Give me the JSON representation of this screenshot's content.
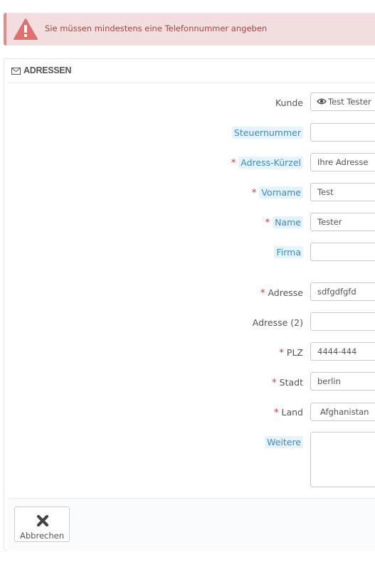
{
  "alert": {
    "message": "Sie müssen mindestens eine Telefonnummer angeben",
    "icon": "warning-icon",
    "color": "#a94442"
  },
  "panel": {
    "title": "ADRESSEN",
    "icon": "envelope-icon"
  },
  "form": {
    "customer_label": "Kunde",
    "customer_value": "Test Tester",
    "tax_number_label": "Steuernummer",
    "tax_number_value": "",
    "alias_label": "Adress-Kürzel",
    "alias_value": "Ihre Adresse",
    "firstname_label": "Vorname",
    "firstname_value": "Test",
    "lastname_label": "Name",
    "lastname_value": "Tester",
    "company_label": "Firma",
    "company_value": "",
    "address1_label": "Adresse",
    "address1_value": "sdfgdfgfd",
    "address2_label": "Adresse (2)",
    "address2_value": "",
    "postcode_label": "PLZ",
    "postcode_value": "4444-444",
    "city_label": "Stadt",
    "city_value": "berlin",
    "country_label": "Land",
    "country_value": "Afghanistan",
    "other_label": "Weitere",
    "other_value": "",
    "required_marker": "*"
  },
  "footer": {
    "cancel_label": "Abbrechen",
    "cancel_icon": "close-icon"
  },
  "colors": {
    "alert_bg": "#f2dede",
    "required": "#e02b2b",
    "hint_label": "#3f8abf"
  }
}
